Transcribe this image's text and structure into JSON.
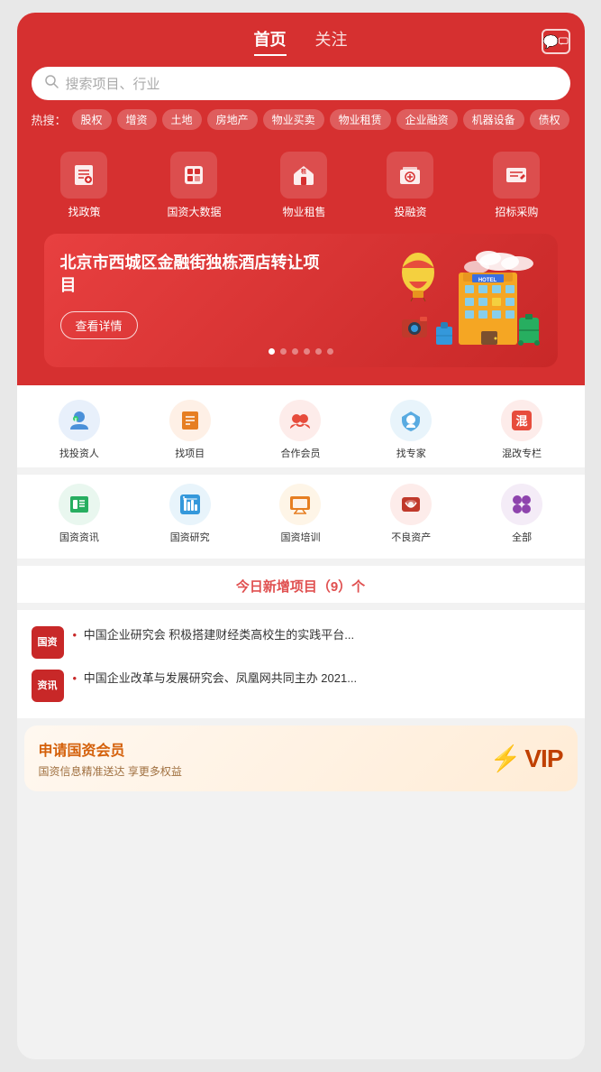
{
  "header": {
    "nav": [
      {
        "label": "首页",
        "active": true
      },
      {
        "label": "关注",
        "active": false
      }
    ],
    "message_icon": "message-square"
  },
  "search": {
    "placeholder": "搜索项目、行业"
  },
  "hot_search": {
    "label": "热搜：",
    "tags": [
      "股权",
      "增资",
      "土地",
      "房地产",
      "物业买卖",
      "物业租赁",
      "企业融资",
      "机器设备",
      "债权"
    ]
  },
  "quick_menu": [
    {
      "label": "找政策",
      "icon": "📋"
    },
    {
      "label": "国资大数据",
      "icon": "🏠"
    },
    {
      "label": "物业租售",
      "icon": "🏘️"
    },
    {
      "label": "投融资",
      "icon": "🏦"
    },
    {
      "label": "招标采购",
      "icon": "📦"
    }
  ],
  "banner": {
    "title": "北京市西城区金融街独栋酒店转让项目",
    "button": "查看详情",
    "dots": 6,
    "active_dot": 0
  },
  "secondary_menu": [
    {
      "label": "找投资人",
      "icon_color": "#4a90d9",
      "icon": "👤"
    },
    {
      "label": "找项目",
      "icon_color": "#e67e22",
      "icon": "📁"
    },
    {
      "label": "合作会员",
      "icon_color": "#e74c3c",
      "icon": "🤝"
    },
    {
      "label": "找专家",
      "icon_color": "#3498db",
      "icon": "🎓"
    },
    {
      "label": "混改专栏",
      "icon_color": "#e74c3c",
      "icon": "⚙️"
    }
  ],
  "third_menu": [
    {
      "label": "国资资讯",
      "icon_color": "#27ae60",
      "icon": "📰"
    },
    {
      "label": "国资研究",
      "icon_color": "#3498db",
      "icon": "📊"
    },
    {
      "label": "国资培训",
      "icon_color": "#e67e22",
      "icon": "🎯"
    },
    {
      "label": "不良资产",
      "icon_color": "#c0392b",
      "icon": "💾"
    },
    {
      "label": "全部",
      "icon_color": "#8e44ad",
      "icon": "⚙️"
    }
  ],
  "today_new": {
    "text": "今日新增项目（9）个"
  },
  "news": [
    {
      "tag_line1": "国资",
      "tag_line2": "",
      "tag_type": "guozi",
      "text": "中国企业研究会 积极搭建财经类高校生的实践平台..."
    },
    {
      "tag_line1": "资讯",
      "tag_line2": "",
      "tag_type": "xun",
      "text": "中国企业改革与发展研究会、凤凰网共同主办 2021..."
    }
  ],
  "vip_banner": {
    "title": "申请国资会员",
    "subtitle": "国资信息精准送达 享更多权益",
    "badge_text": "VIP"
  },
  "colors": {
    "primary": "#d63030",
    "accent": "#f07020",
    "vip_text": "#c04000"
  }
}
